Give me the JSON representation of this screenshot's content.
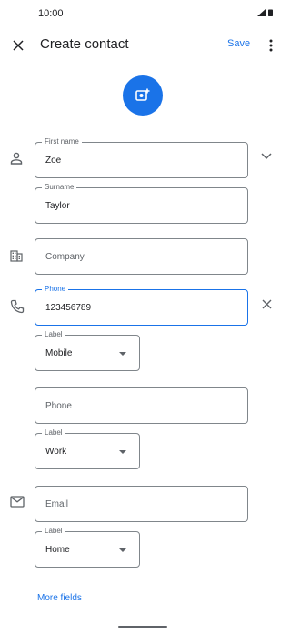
{
  "status": {
    "time": "10:00"
  },
  "header": {
    "title": "Create contact",
    "save_label": "Save"
  },
  "name": {
    "first_label": "First name",
    "first_value": "Zoe",
    "surname_label": "Surname",
    "surname_value": "Taylor"
  },
  "company": {
    "placeholder": "Company"
  },
  "phones": [
    {
      "label": "Phone",
      "value": "123456789",
      "type_label": "Label",
      "type_value": "Mobile"
    },
    {
      "placeholder": "Phone",
      "type_label": "Label",
      "type_value": "Work"
    }
  ],
  "email": {
    "placeholder": "Email",
    "type_label": "Label",
    "type_value": "Home"
  },
  "footer": {
    "more_fields": "More fields"
  },
  "colors": {
    "accent": "#1a73e8",
    "icon": "#5f6368",
    "outline": "#80868b",
    "text": "#202124"
  }
}
